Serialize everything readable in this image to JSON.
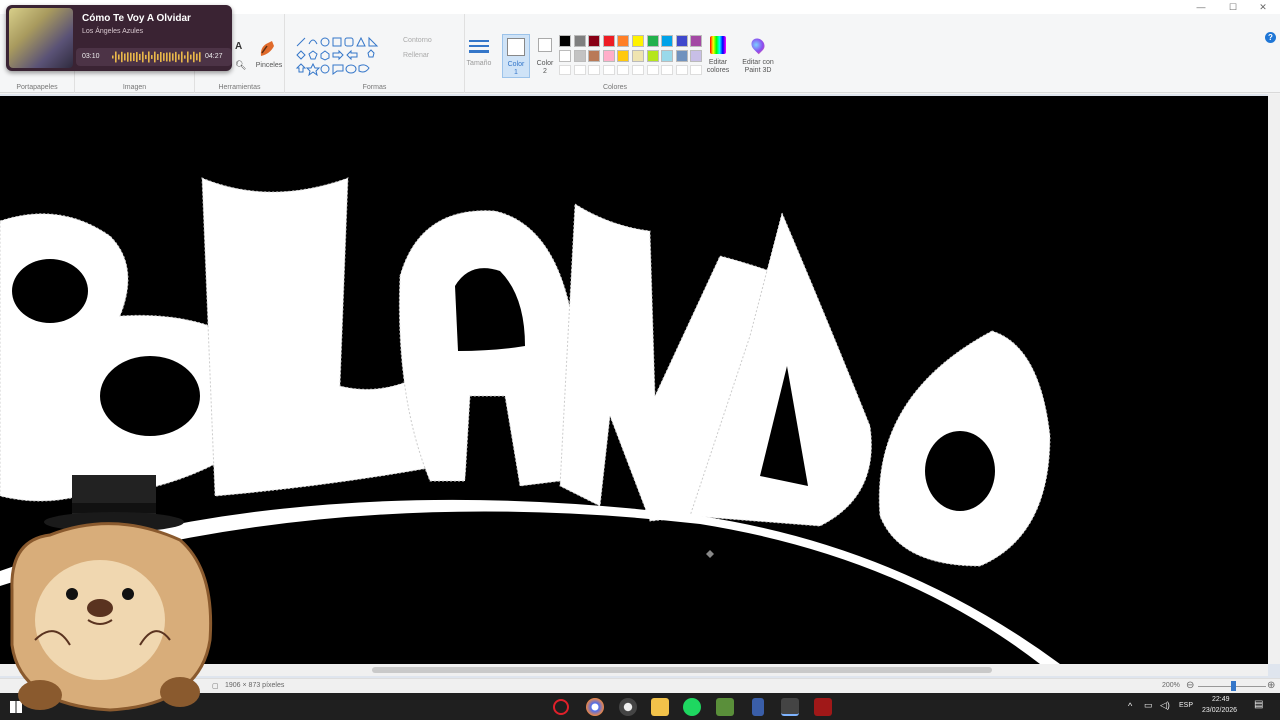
{
  "window": {
    "minimize": "—",
    "maximize": "☐",
    "close": "✕"
  },
  "ribbon": {
    "groups": {
      "clipboard": "Portapapeles",
      "image": "Imagen",
      "tools": "Herramientas",
      "shapes": "Formas",
      "colors": "Colores"
    },
    "brushes_label": "Pinceles",
    "outline_label": "Contorno",
    "fill_label": "Rellenar",
    "size_label": "Tamaño",
    "color1_label": "Color\n1",
    "color2_label": "Color\n2",
    "edit_colors_label": "Editar colores",
    "paint3d_label": "Editar con Paint 3D",
    "palette_row1": [
      "#000000",
      "#7f7f7f",
      "#880015",
      "#ed1c24",
      "#ff7f27",
      "#fff200",
      "#22b14c",
      "#00a2e8",
      "#3f48cc",
      "#a349a4"
    ],
    "palette_row2": [
      "#ffffff",
      "#c3c3c3",
      "#b97a57",
      "#ffaec9",
      "#ffc90e",
      "#efe4b0",
      "#b5e61d",
      "#99d9ea",
      "#7092be",
      "#c8bfe7"
    ]
  },
  "media": {
    "song": "Cómo Te Voy A Olvidar",
    "artist": "Los Ángeles Azules",
    "elapsed": "03:10",
    "total": "04:27"
  },
  "canvas": {
    "letters": [
      "B",
      "L",
      "A",
      "N",
      "D",
      "O"
    ]
  },
  "statusbar": {
    "dimensions": "1906 × 873 píxeles",
    "zoom": "200%"
  },
  "taskbar": {
    "lang": "ESP",
    "time": "22:49",
    "date": "23/02/2026"
  }
}
